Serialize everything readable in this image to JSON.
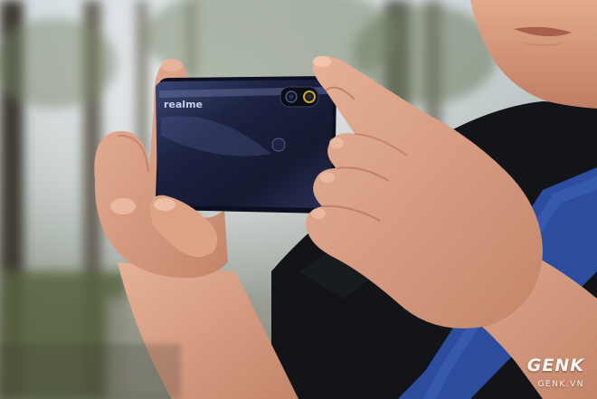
{
  "photo": {
    "phone_brand_text": "realme",
    "watermark_logo": "GENK",
    "watermark_url": "GENK.VN"
  },
  "colors": {
    "phone_body": "#1c2240",
    "phone_highlight": "#4a5580",
    "skin": "#d9a082",
    "skin_shadow": "#b9785e",
    "shirt": "#111316",
    "strap": "#2a4a9a",
    "forest_bg": "#5d6b5a",
    "sky_bg": "#dfe5ea"
  }
}
